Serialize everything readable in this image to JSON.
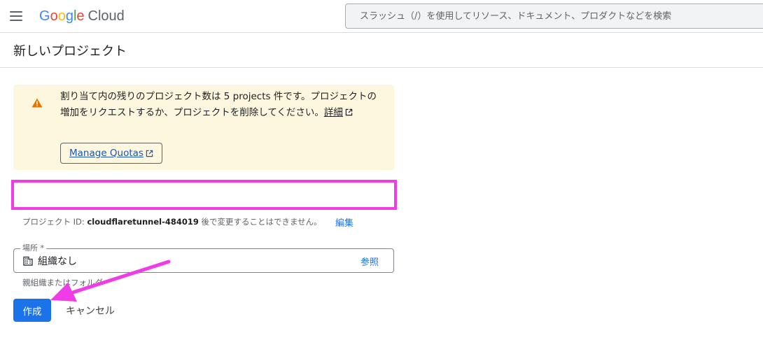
{
  "header": {
    "logo": {
      "G": "G",
      "o1": "o",
      "o2": "o",
      "g": "g",
      "l": "l",
      "e": "e",
      "cloud": "Cloud"
    },
    "search_placeholder": "スラッシュ（/）を使用してリソース、ドキュメント、プロダクトなどを検索"
  },
  "page": {
    "title": "新しいプロジェクト"
  },
  "alert": {
    "message": "割り当て内の残りのプロジェクト数は 5 projects 件です。プロジェクトの増加をリクエストするか、プロジェクトを削除してください。",
    "more_link": "詳細",
    "button_label": "Manage Quotas"
  },
  "project_name": {
    "value": ""
  },
  "project_id": {
    "prefix": "プロジェクト ID: ",
    "id": "cloudflaretunnel-484019",
    "suffix": " 後で変更することはできません。",
    "edit_label": "編集"
  },
  "location": {
    "label": "場所 *",
    "value": "組織なし",
    "browse_label": "参照",
    "hint": "親組織またはフォルダ"
  },
  "actions": {
    "create_label": "作成",
    "cancel_label": "キャンセル"
  },
  "colors": {
    "primary": "#1a73e8",
    "alert_bg": "#fef7e0",
    "warning": "#e37400",
    "highlight": "#f03ce6"
  },
  "icons": {
    "menu": "menu-icon",
    "warning": "warning-icon",
    "external": "external-link-icon",
    "building": "building-icon",
    "annotation": "annotation-arrow"
  }
}
